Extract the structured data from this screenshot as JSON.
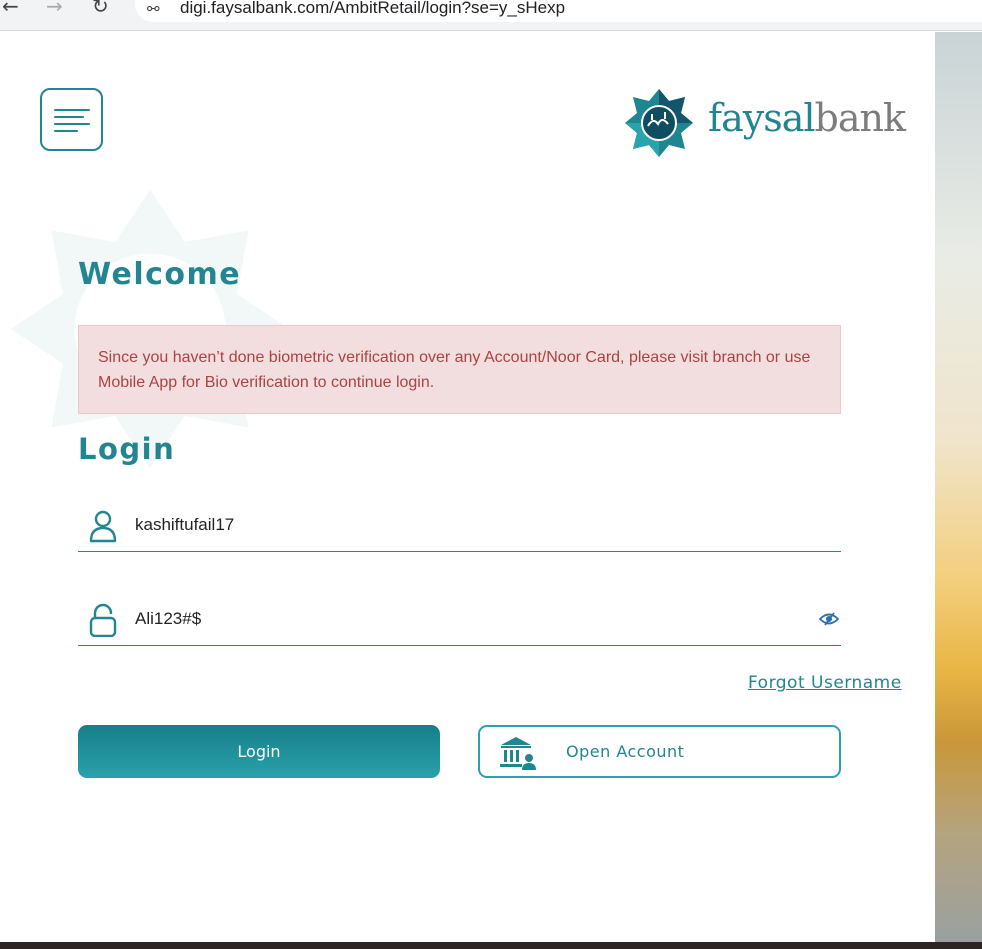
{
  "browser": {
    "back_icon": "arrow-left-icon",
    "forward_icon": "arrow-right-icon",
    "reload_icon": "reload-icon",
    "site_info_icon": "tune-icon",
    "url": "digi.faysalbank.com/AmbitRetail/login?se=y_sHexp"
  },
  "header": {
    "menu_icon": "hamburger-icon",
    "logo": {
      "part1": "faysal",
      "part2": "bank"
    }
  },
  "main": {
    "welcome": "Welcome",
    "alert": "Since you haven’t done biometric verification over any Account/Noor Card, please visit branch or use Mobile App for Bio verification to continue login.",
    "login_title": "Login",
    "username": {
      "icon": "user-icon",
      "value": "kashiftufail17"
    },
    "password": {
      "icon": "lock-icon",
      "value": "Ali123#$",
      "toggle_icon": "eye-icon"
    },
    "forgot_username": "Forgot Username",
    "login_button": "Login",
    "open_account": {
      "icon": "bank-user-icon",
      "label": "Open Account"
    }
  },
  "colors": {
    "brand": "#22858f",
    "alert_bg": "#f2dedf",
    "alert_text": "#a94442"
  }
}
